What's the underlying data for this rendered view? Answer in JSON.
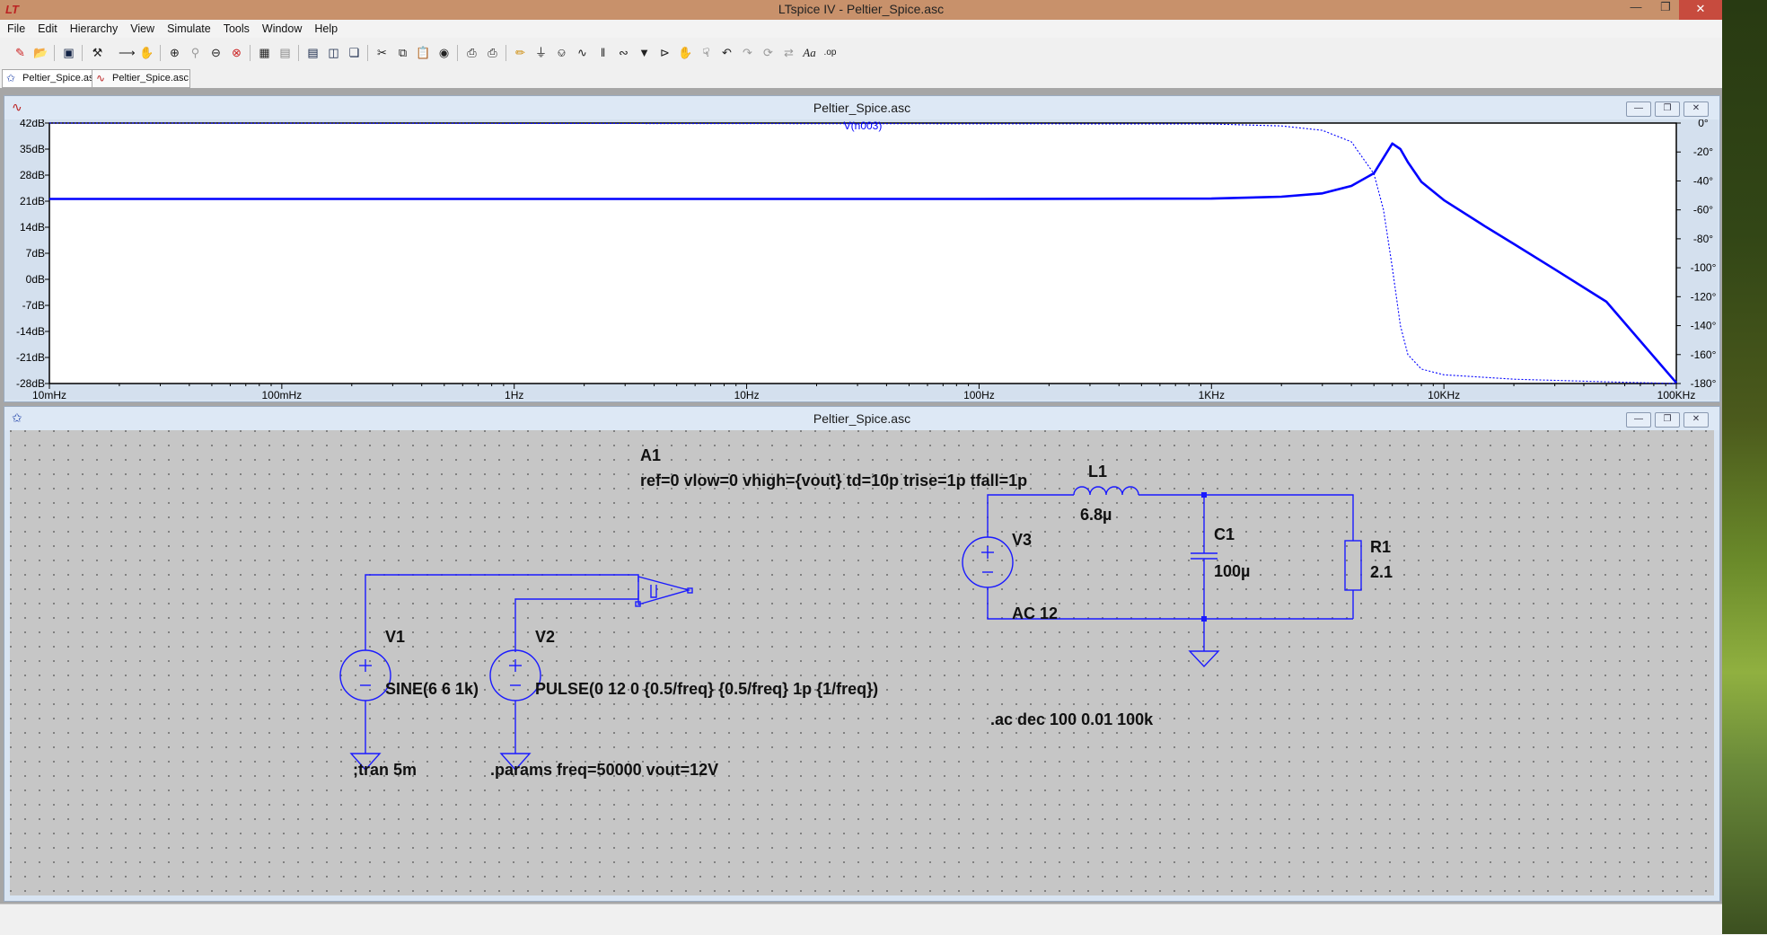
{
  "window": {
    "title": "LTspice IV - Peltier_Spice.asc",
    "app_icon": "LT"
  },
  "menu": [
    "File",
    "Edit",
    "Hierarchy",
    "View",
    "Simulate",
    "Tools",
    "Window",
    "Help"
  ],
  "tabs": [
    {
      "label": "Peltier_Spice.asc",
      "icon": "schematic-icon"
    },
    {
      "label": "Peltier_Spice.asc",
      "icon": "waveform-icon"
    }
  ],
  "waveform_window": {
    "title": "Peltier_Spice.asc",
    "trace_label": "V(n003)",
    "colors": {
      "trace": "#0000ff",
      "background": "#ffffff"
    }
  },
  "schematic_window": {
    "title": "Peltier_Spice.asc"
  },
  "chart_data": {
    "type": "line",
    "title": "V(n003)",
    "x_scale": "log",
    "xlim": [
      0.01,
      100000
    ],
    "x_ticks": [
      "10mHz",
      "100mHz",
      "1Hz",
      "10Hz",
      "100Hz",
      "1KHz",
      "10KHz",
      "100KHz"
    ],
    "y_left_ticks": [
      "42dB",
      "35dB",
      "28dB",
      "21dB",
      "14dB",
      "7dB",
      "0dB",
      "-7dB",
      "-14dB",
      "-21dB",
      "-28dB"
    ],
    "y_left_lim": [
      -28,
      42
    ],
    "y_right_ticks": [
      "0°",
      "-20°",
      "-40°",
      "-60°",
      "-80°",
      "-100°",
      "-120°",
      "-140°",
      "-160°",
      "-180°"
    ],
    "y_right_lim": [
      -180,
      0
    ],
    "series": [
      {
        "name": "V(n003)",
        "line": "solid",
        "x": [
          0.01,
          100,
          1000,
          2000,
          3000,
          4000,
          5000,
          6000,
          6500,
          7000,
          8000,
          10000,
          15000,
          20000,
          30000,
          50000,
          100000
        ],
        "y": [
          21.6,
          21.6,
          21.7,
          22.2,
          23.1,
          25.1,
          28.5,
          36.5,
          35.0,
          31.5,
          26.2,
          21.3,
          14.3,
          9.5,
          2.7,
          -6.0,
          -27.8
        ]
      },
      {
        "name": "V(n003) phase",
        "line": "dotted",
        "x": [
          0.01,
          1000,
          2000,
          3000,
          4000,
          5000,
          5500,
          6000,
          6500,
          7000,
          8000,
          10000,
          20000,
          50000,
          100000
        ],
        "y": [
          0,
          -0.6,
          -2,
          -5,
          -13,
          -35,
          -60,
          -100,
          -140,
          -160,
          -170,
          -174,
          -177,
          -178.8,
          -180
        ]
      }
    ]
  },
  "schematic": {
    "components": [
      {
        "ref": "A1",
        "value": "ref=0 vlow=0 vhigh={vout} td=10p trise=1p tfall=1p"
      },
      {
        "ref": "L1",
        "value": "6.8µ"
      },
      {
        "ref": "C1",
        "value": "100µ"
      },
      {
        "ref": "R1",
        "value": "2.1"
      },
      {
        "ref": "V3",
        "value": "AC 12"
      },
      {
        "ref": "V1",
        "value": "SINE(6 6 1k)"
      },
      {
        "ref": "V2",
        "value": "PULSE(0 12 0 {0.5/freq} {0.5/freq} 1p {1/freq})"
      }
    ],
    "directives": [
      ".ac dec 100 0.01 100k",
      ";tran 5m",
      ".params freq=50000 vout=12V"
    ]
  }
}
